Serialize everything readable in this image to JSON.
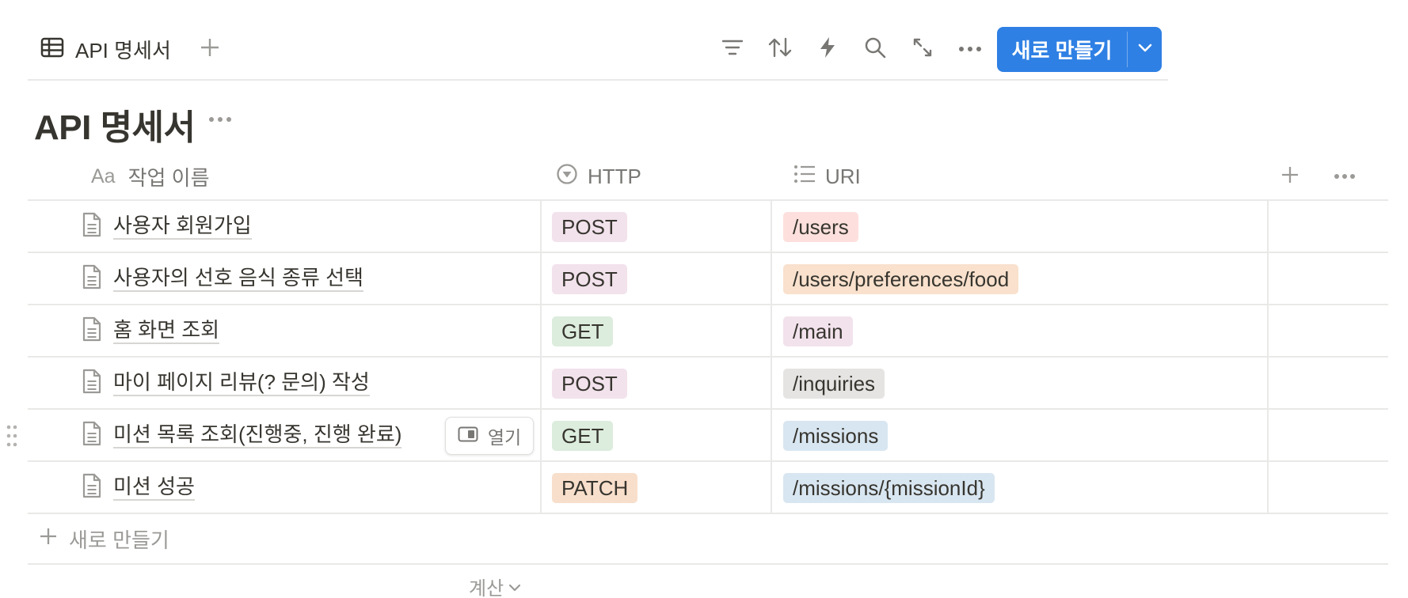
{
  "view": {
    "tab_label": "API 명세서",
    "tab_icon": "table-icon",
    "add_view_icon": "plus-icon"
  },
  "toolbar": {
    "icons": [
      "filter-icon",
      "sort-icon",
      "automation-bolt-icon",
      "search-icon",
      "expand-icon",
      "more-icon"
    ],
    "new_button_label": "새로 만들기",
    "accent_color": "#2f80e4"
  },
  "database": {
    "title": "API 명세서"
  },
  "columns": {
    "name": {
      "prefix": "Aa",
      "label": "작업 이름"
    },
    "http": {
      "label": "HTTP",
      "icon": "select-icon"
    },
    "uri": {
      "label": "URI",
      "icon": "list-icon"
    }
  },
  "rows": [
    {
      "name": "사용자 회원가입",
      "http": "POST",
      "http_color": "#f2e2ec",
      "uri": "/users",
      "uri_color": "#fde0dd"
    },
    {
      "name": "사용자의 선호 음식 종류 선택",
      "http": "POST",
      "http_color": "#f2e2ec",
      "uri": "/users/preferences/food",
      "uri_color": "#f9e1cd"
    },
    {
      "name": "홈 화면 조회",
      "http": "GET",
      "http_color": "#dcecdd",
      "uri": "/main",
      "uri_color": "#f2e2ec"
    },
    {
      "name": "마이 페이지 리뷰(? 문의) 작성",
      "http": "POST",
      "http_color": "#f2e2ec",
      "uri": "/inquiries",
      "uri_color": "#e5e4e2"
    },
    {
      "name": "미션 목록 조회(진행중, 진행 완료)",
      "http": "GET",
      "http_color": "#dcecdd",
      "uri": "/missions",
      "uri_color": "#d8e6f1"
    },
    {
      "name": "미션 성공",
      "http": "PATCH",
      "http_color": "#f8dfcb",
      "uri": "/missions/{missionId}",
      "uri_color": "#d8e6f1"
    }
  ],
  "open_button_label": "열기",
  "new_row_label": "새로 만들기",
  "calculate_label": "계산"
}
